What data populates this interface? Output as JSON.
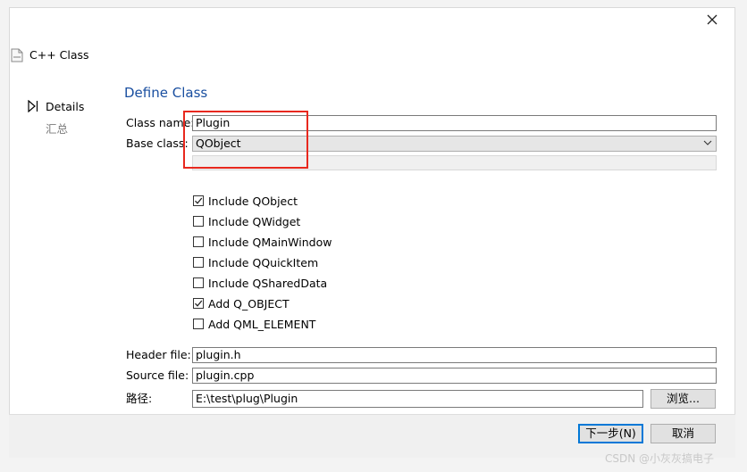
{
  "wizard": {
    "title": "C++ Class"
  },
  "nav": {
    "details": "Details",
    "summary": "汇总"
  },
  "section": {
    "title": "Define Class"
  },
  "form": {
    "class_name_label": "Class name:",
    "class_name_value": "Plugin",
    "base_class_label": "Base class:",
    "base_class_value": "QObject",
    "header_label": "Header file:",
    "header_value": "plugin.h",
    "source_label": "Source file:",
    "source_value": "plugin.cpp",
    "path_label": "路径:",
    "path_value": "E:\\test\\plug\\Plugin",
    "browse_label": "浏览..."
  },
  "options": [
    {
      "label": "Include QObject",
      "checked": true
    },
    {
      "label": "Include QWidget",
      "checked": false
    },
    {
      "label": "Include QMainWindow",
      "checked": false
    },
    {
      "label": "Include QQuickItem",
      "checked": false
    },
    {
      "label": "Include QSharedData",
      "checked": false
    },
    {
      "label": "Add Q_OBJECT",
      "checked": true
    },
    {
      "label": "Add QML_ELEMENT",
      "checked": false
    }
  ],
  "buttons": {
    "next": "下一步(N)",
    "cancel": "取消"
  },
  "watermark": "CSDN @小灰灰搞电子",
  "colors": {
    "accent": "#0078d7",
    "title": "#1a4fa0",
    "highlight": "#e8281e"
  }
}
